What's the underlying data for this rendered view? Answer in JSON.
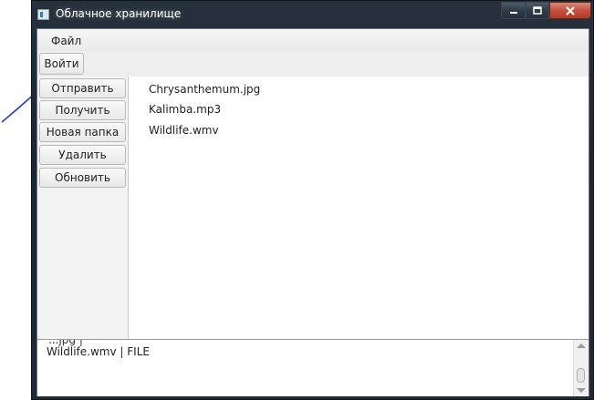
{
  "window": {
    "title": "Облачное хранилище",
    "icon": "app-window-icon"
  },
  "menu": {
    "file_label": "Файл"
  },
  "toolbar": {
    "login_label": "Войти"
  },
  "sidebar": {
    "buttons": [
      {
        "label": "Отправить"
      },
      {
        "label": "Получить"
      },
      {
        "label": "Новая папка"
      },
      {
        "label": "Удалить"
      },
      {
        "label": "Обновить"
      }
    ]
  },
  "files": [
    {
      "name": "Chrysanthemum.jpg"
    },
    {
      "name": "Kalimba.mp3"
    },
    {
      "name": "Wildlife.wmv"
    }
  ],
  "log": {
    "partial_line": "...jpg |",
    "last_line": "Wildlife.wmv | FILE"
  },
  "colors": {
    "annotation_arrow": "#1a3fd6",
    "close_button": "#c4503c"
  }
}
